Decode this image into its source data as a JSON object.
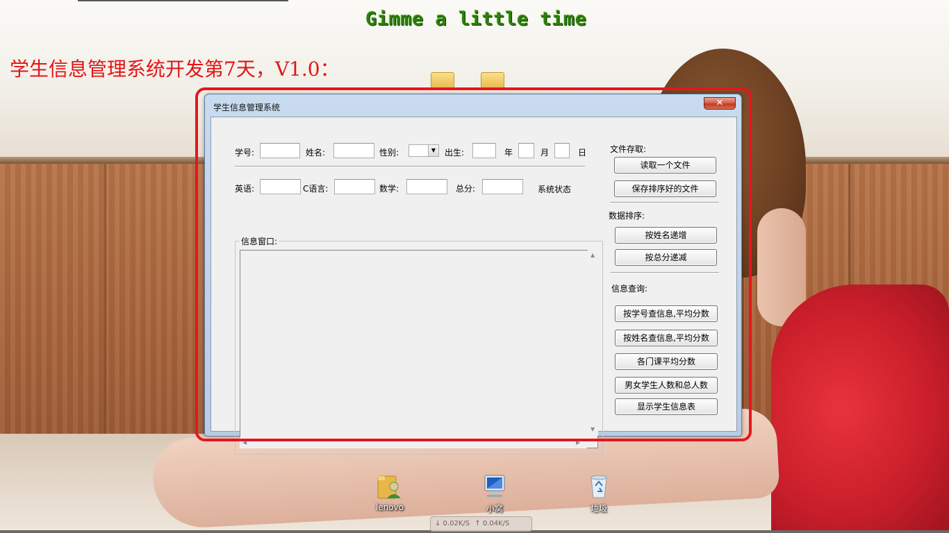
{
  "banner_title": "Gimme a little time",
  "headline": "学生信息管理系统开发第7天，V1.0：",
  "window": {
    "title": "学生信息管理系统",
    "close_glyph": "✕",
    "form": {
      "student_id_label": "学号:",
      "name_label": "姓名:",
      "gender_label": "性别:",
      "birth_label": "出生:",
      "year_label": "年",
      "month_label": "月",
      "day_label": "日",
      "english_label": "英语:",
      "c_label": "C语言:",
      "math_label": "数学:",
      "total_label": "总分:",
      "status_label": "系统状态"
    },
    "info_window": {
      "label": "信息窗口:",
      "content": ""
    },
    "file_section": {
      "label": "文件存取:",
      "read_button": "读取一个文件",
      "save_button": "保存排序好的文件"
    },
    "sort_section": {
      "label": "数据排序:",
      "by_name_asc_button": "按姓名递增",
      "by_total_desc_button": "按总分递减"
    },
    "query_section": {
      "label": "信息查询:",
      "by_id_button": "按学号查信息,平均分数",
      "by_name_button": "按姓名查信息,平均分数",
      "course_avg_button": "各门课平均分数",
      "gender_count_button": "男女学生人数和总人数",
      "show_table_button": "显示学生信息表"
    }
  },
  "desktop_icons": [
    {
      "label": "lenovo",
      "icon": "user-folder-icon"
    },
    {
      "label": "小窝",
      "icon": "computer-icon"
    },
    {
      "label": "垃圾",
      "icon": "recycle-bin-icon"
    }
  ],
  "net_widget": {
    "download": "↓ 0.02K/S",
    "upload": "↑ 0.04K/S"
  },
  "colors": {
    "headline": "#e41414",
    "banner": "#2e7d10",
    "highlight": "#e5161e",
    "window_frame": "#b7cde6"
  }
}
